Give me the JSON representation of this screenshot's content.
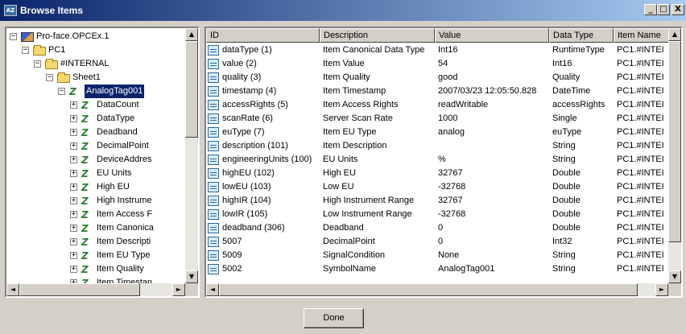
{
  "window": {
    "title": "Browse Items",
    "title_icon_text": "AZ",
    "btn_min": "_",
    "btn_max": "□",
    "btn_close": "X"
  },
  "tree": {
    "nodes": [
      {
        "label": "Pro-face.OPCEx.1",
        "icon": "server-icon",
        "expander": "−"
      },
      {
        "label": "PC1",
        "icon": "folder-icon",
        "expander": "−"
      },
      {
        "label": "#INTERNAL",
        "icon": "folder-icon",
        "expander": "−"
      },
      {
        "label": "Sheet1",
        "icon": "folder-icon",
        "expander": "−"
      },
      {
        "label": "AnalogTag001",
        "icon": "tag-icon",
        "expander": "−",
        "selected": true
      },
      {
        "label": "DataCount",
        "icon": "tag-icon",
        "expander": "+"
      },
      {
        "label": "DataType",
        "icon": "tag-icon",
        "expander": "+"
      },
      {
        "label": "Deadband",
        "icon": "tag-icon",
        "expander": "+"
      },
      {
        "label": "DecimalPoint",
        "icon": "tag-icon",
        "expander": "+"
      },
      {
        "label": "DeviceAddres",
        "icon": "tag-icon",
        "expander": "+"
      },
      {
        "label": "EU Units",
        "icon": "tag-icon",
        "expander": "+"
      },
      {
        "label": "High EU",
        "icon": "tag-icon",
        "expander": "+"
      },
      {
        "label": "High Instrume",
        "icon": "tag-icon",
        "expander": "+"
      },
      {
        "label": "Item Access F",
        "icon": "tag-icon",
        "expander": "+"
      },
      {
        "label": "Item Canonica",
        "icon": "tag-icon",
        "expander": "+"
      },
      {
        "label": "Item Descripti",
        "icon": "tag-icon",
        "expander": "+"
      },
      {
        "label": "Item EU Type",
        "icon": "tag-icon",
        "expander": "+"
      },
      {
        "label": "Item Quality",
        "icon": "tag-icon",
        "expander": "+"
      },
      {
        "label": "Item Timestan",
        "icon": "tag-icon",
        "expander": "+"
      }
    ]
  },
  "list": {
    "columns": [
      "ID",
      "Description",
      "Value",
      "Data Type",
      "Item Name"
    ],
    "rows": [
      [
        "dataType (1)",
        "Item Canonical Data Type",
        "Int16",
        "RuntimeType",
        "PC1.#INTEI"
      ],
      [
        "value (2)",
        "Item Value",
        "54",
        "Int16",
        "PC1.#INTEI"
      ],
      [
        "quality (3)",
        "Item Quality",
        "good",
        "Quality",
        "PC1.#INTEI"
      ],
      [
        "timestamp (4)",
        "Item Timestamp",
        "2007/03/23 12:05:50.828",
        "DateTime",
        "PC1.#INTEI"
      ],
      [
        "accessRights (5)",
        "Item Access Rights",
        "readWritable",
        "accessRights",
        "PC1.#INTEI"
      ],
      [
        "scanRate (6)",
        "Server Scan Rate",
        "1000",
        "Single",
        "PC1.#INTEI"
      ],
      [
        "euType (7)",
        "Item EU Type",
        "analog",
        "euType",
        "PC1.#INTEI"
      ],
      [
        "description (101)",
        "Item Description",
        "",
        "String",
        "PC1.#INTEI"
      ],
      [
        "engineeringUnits (100)",
        "EU Units",
        "%",
        "String",
        "PC1.#INTEI"
      ],
      [
        "highEU (102)",
        "High EU",
        "32767",
        "Double",
        "PC1.#INTEI"
      ],
      [
        "lowEU (103)",
        "Low EU",
        "-32768",
        "Double",
        "PC1.#INTEI"
      ],
      [
        "highIR (104)",
        "High Instrument Range",
        "32767",
        "Double",
        "PC1.#INTEI"
      ],
      [
        "lowIR (105)",
        "Low Instrument Range",
        "-32768",
        "Double",
        "PC1.#INTEI"
      ],
      [
        "deadband (306)",
        "Deadband",
        "0",
        "Double",
        "PC1.#INTEI"
      ],
      [
        "5007",
        "DecimalPoint",
        "0",
        "Int32",
        "PC1.#INTEI"
      ],
      [
        "5009",
        "SignalCondition",
        "None",
        "String",
        "PC1.#INTEI"
      ],
      [
        "5002",
        "SymbolName",
        "AnalogTag001",
        "String",
        "PC1.#INTEI"
      ]
    ]
  },
  "scroll": {
    "up": "▲",
    "down": "▼",
    "left": "◄",
    "right": "►"
  },
  "done_label": "Done"
}
